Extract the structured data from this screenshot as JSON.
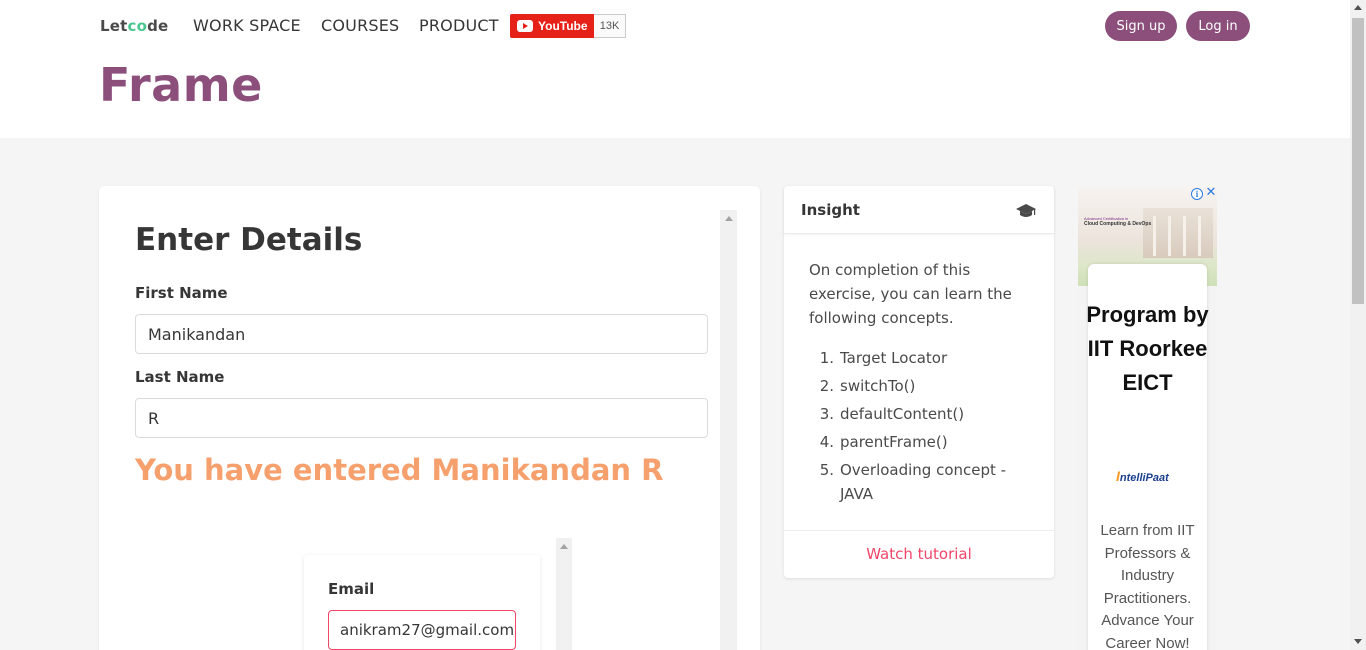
{
  "header": {
    "logo": {
      "pre": "Let",
      "accent": "co",
      "post": "de"
    },
    "nav": [
      "WORK SPACE",
      "COURSES",
      "PRODUCT"
    ],
    "youtube": {
      "label": "YouTube",
      "count": "13K"
    },
    "signup_label": "Sign up",
    "login_label": "Log in"
  },
  "page_title": "Frame",
  "form": {
    "heading": "Enter Details",
    "first_name_label": "First Name",
    "first_name_value": "Manikandan",
    "last_name_label": "Last Name",
    "last_name_value": "R",
    "result_text": "You have entered Manikandan R",
    "email_label": "Email",
    "email_value": "anikram27@gmail.com"
  },
  "insight": {
    "title": "Insight",
    "intro": "On completion of this exercise, you can learn the following concepts.",
    "items": [
      {
        "num": "1.",
        "text": "Target Locator"
      },
      {
        "num": "2.",
        "text": "switchTo()"
      },
      {
        "num": "3.",
        "text": "defaultContent()"
      },
      {
        "num": "4.",
        "text": "parentFrame()"
      },
      {
        "num": "5.",
        "text": "Overloading concept - JAVA"
      }
    ],
    "footer_link": "Watch tutorial"
  },
  "ad": {
    "banner_line1": "Advanced Certification in",
    "banner_line2": "Cloud Computing & DevOps",
    "headline": "Program by IIT Roorkee EICT",
    "brand": "ntelliPaat",
    "brand_initial": "I",
    "description": "Learn from IIT Professors & Industry Practitioners. Advance Your Career Now!",
    "info_symbol": "i",
    "close_symbol": "✕"
  },
  "colors": {
    "brand": "#8c4f7b",
    "result": "#f5a06d",
    "danger": "#f14668",
    "youtube": "#e62117"
  }
}
